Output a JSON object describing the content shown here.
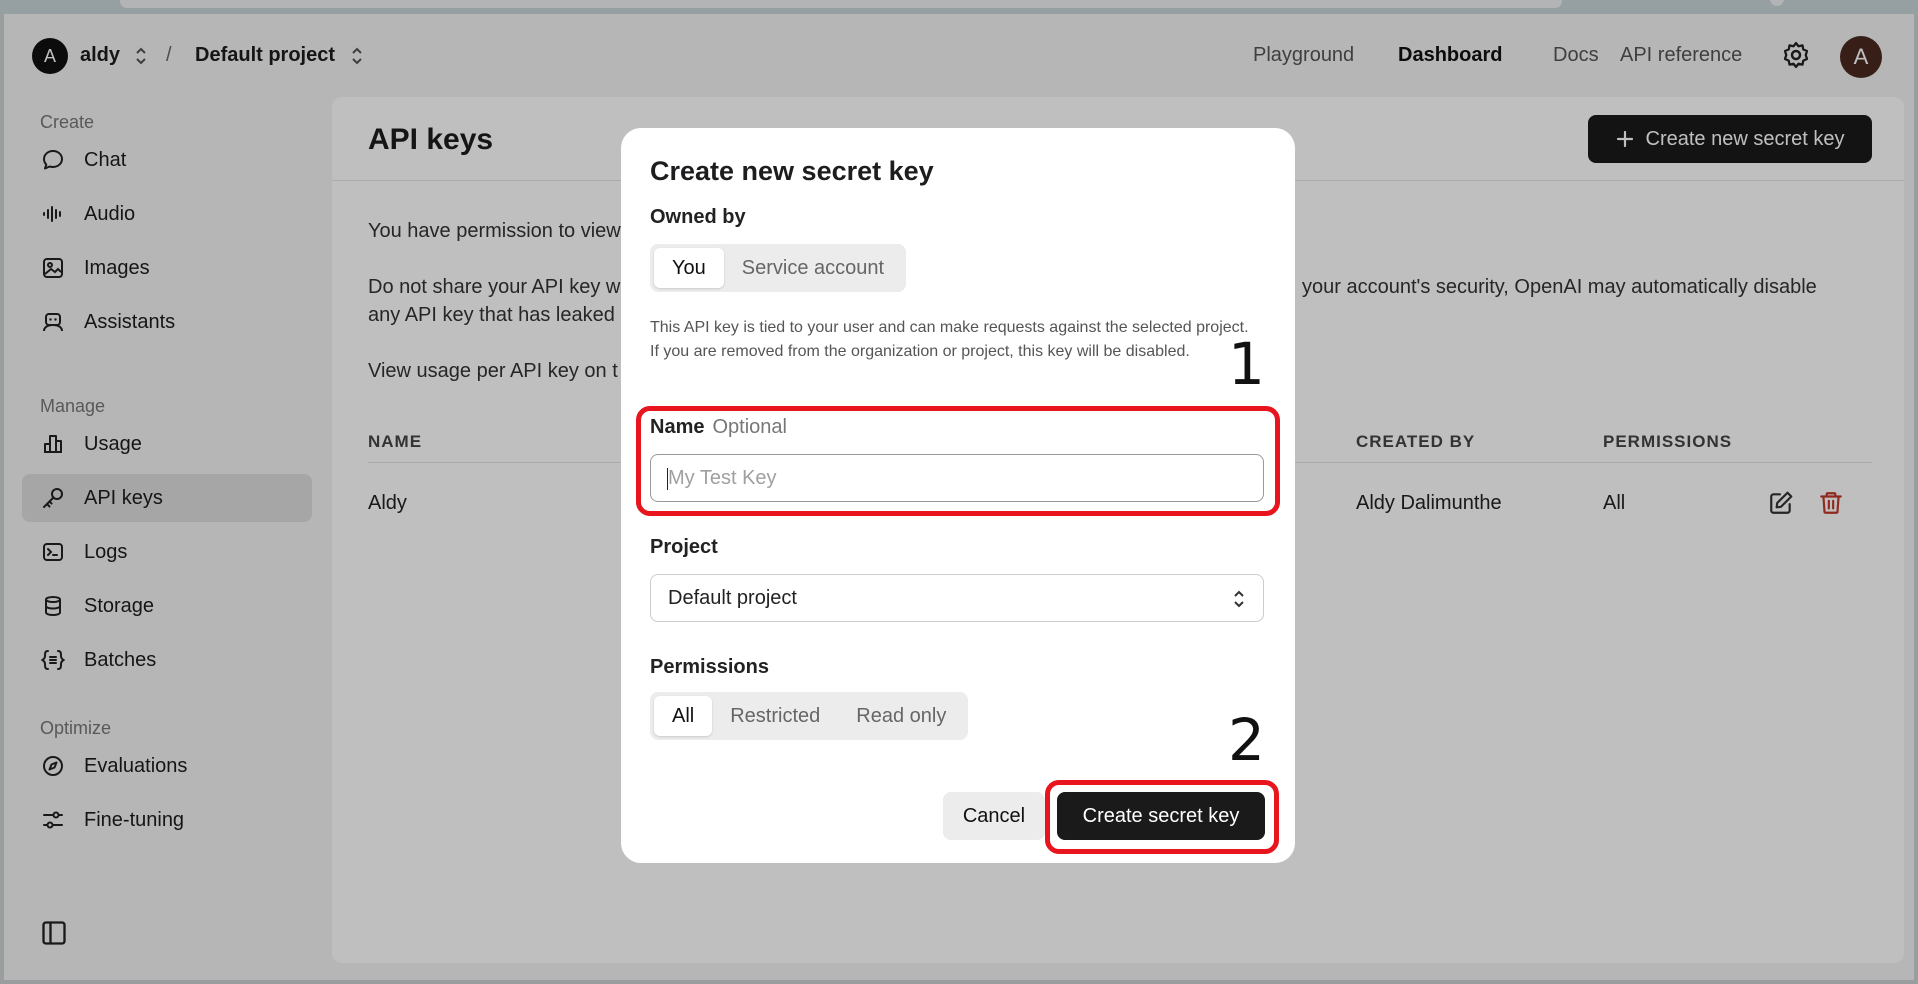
{
  "org": {
    "avatar_letter": "A",
    "name": "aldy"
  },
  "breadcrumb": {
    "separator": "/",
    "project": "Default project"
  },
  "nav": {
    "playground": "Playground",
    "dashboard": "Dashboard",
    "docs": "Docs",
    "api_reference": "API reference"
  },
  "user": {
    "avatar_letter": "A"
  },
  "sidebar": {
    "sections": {
      "create": "Create",
      "manage": "Manage",
      "optimize": "Optimize"
    },
    "items": {
      "chat": "Chat",
      "audio": "Audio",
      "images": "Images",
      "assistants": "Assistants",
      "usage": "Usage",
      "api_keys": "API keys",
      "logs": "Logs",
      "storage": "Storage",
      "batches": "Batches",
      "evaluations": "Evaluations",
      "fine_tuning": "Fine-tuning"
    }
  },
  "page": {
    "title": "API keys",
    "create_button": "Create new secret key",
    "permission_text": "You have permission to view",
    "share_left": "Do not share your API key w",
    "share_right": "your account's security, OpenAI may automatically disable",
    "share_line2": "any API key that has leaked",
    "usage_text": "View usage per API key on t"
  },
  "table": {
    "headers": {
      "name": "NAME",
      "created_by": "CREATED BY",
      "permissions": "PERMISSIONS"
    },
    "rows": [
      {
        "name": "Aldy",
        "created_by": "Aldy Dalimunthe",
        "permissions": "All"
      }
    ]
  },
  "modal": {
    "title": "Create new secret key",
    "owned_by_label": "Owned by",
    "owned_by_options": {
      "you": "You",
      "service": "Service account"
    },
    "description": "This API key is tied to your user and can make requests against the selected project. If you are removed from the organization or project, this key will be disabled.",
    "name_label": "Name",
    "name_optional": "Optional",
    "name_value": "",
    "name_placeholder": "My Test Key",
    "project_label": "Project",
    "project_value": "Default project",
    "permissions_label": "Permissions",
    "permissions_options": {
      "all": "All",
      "restricted": "Restricted",
      "read_only": "Read only"
    },
    "cancel": "Cancel",
    "submit": "Create secret key"
  },
  "annotations": {
    "one": "1",
    "two": "2"
  },
  "colors": {
    "annotation": "#e8141e",
    "primary_button": "#1a1a1a",
    "delete_icon": "#c0392b"
  }
}
